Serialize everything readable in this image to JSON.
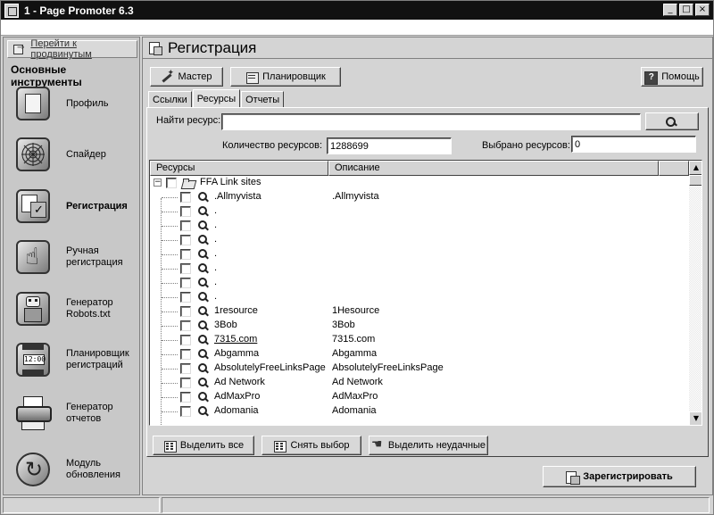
{
  "window": {
    "title": "1 - Page Promoter 6.3"
  },
  "sidebar": {
    "link_label": "Перейти к продвинутым",
    "heading": "Основные инструменты",
    "items": [
      {
        "label_line1": "Профиль",
        "label_line2": "",
        "icon": "profile-icon"
      },
      {
        "label_line1": "Спайдер",
        "label_line2": "",
        "icon": "spider-web-icon"
      },
      {
        "label_line1": "Регистрация",
        "label_line2": "",
        "icon": "registration-icon"
      },
      {
        "label_line1": "Ручная",
        "label_line2": "регистрация",
        "icon": "manual-registration-icon"
      },
      {
        "label_line1": "Генератор",
        "label_line2": "Robots.txt",
        "icon": "robot-icon"
      },
      {
        "label_line1": "Планировщик",
        "label_line2": "регистраций",
        "icon": "scheduler-clock-icon"
      },
      {
        "label_line1": "Генератор",
        "label_line2": "отчетов",
        "icon": "printer-icon"
      },
      {
        "label_line1": "Модуль",
        "label_line2": "обновления",
        "icon": "update-icon"
      }
    ]
  },
  "main": {
    "title": "Регистрация",
    "toolbar": {
      "wizard": "Мастер",
      "scheduler": "Планировщик",
      "help": "Помощь"
    },
    "tabs": [
      {
        "label": "Ссылки"
      },
      {
        "label": "Ресурсы"
      },
      {
        "label": "Отчеты"
      }
    ],
    "search": {
      "label": "Найти ресурс:",
      "value": ""
    },
    "counts": {
      "total_label": "Количество ресурсов:",
      "total_value": "1288699",
      "selected_label": "Выбрано ресурсов:",
      "selected_value": "0"
    },
    "grid": {
      "columns": [
        "Ресурсы",
        "Описание"
      ],
      "group": {
        "name": "FFA Link sites",
        "expanded_symbol": "−"
      },
      "rows": [
        {
          "name": ".Allmyvista",
          "desc": ".Allmyvista",
          "link": false
        },
        {
          "name": ".",
          "desc": "",
          "link": false
        },
        {
          "name": ".",
          "desc": "",
          "link": false
        },
        {
          "name": ".",
          "desc": "",
          "link": false
        },
        {
          "name": ".",
          "desc": "",
          "link": false
        },
        {
          "name": ".",
          "desc": "",
          "link": false
        },
        {
          "name": ".",
          "desc": "",
          "link": false
        },
        {
          "name": ".",
          "desc": "",
          "link": false
        },
        {
          "name": "1resource",
          "desc": "1Hesource",
          "link": false
        },
        {
          "name": "3Bob",
          "desc": "3Bob",
          "link": false
        },
        {
          "name": "7315.com",
          "desc": "7315.com",
          "link": true
        },
        {
          "name": "Abgamma",
          "desc": "Abgamma",
          "link": false
        },
        {
          "name": "AbsolutelyFreeLinksPage",
          "desc": "AbsolutelyFreeLinksPage",
          "link": false
        },
        {
          "name": "Ad Network",
          "desc": "Ad Network",
          "link": false
        },
        {
          "name": "AdMaxPro",
          "desc": "AdMaxPro",
          "link": false
        },
        {
          "name": "Adomania",
          "desc": "Adomania",
          "link": false
        }
      ]
    },
    "actions": {
      "select_all": "Выделить все",
      "deselect": "Снять выбор",
      "select_failed": "Выделить неудачные"
    },
    "register_button": "Зарегистрировать"
  }
}
